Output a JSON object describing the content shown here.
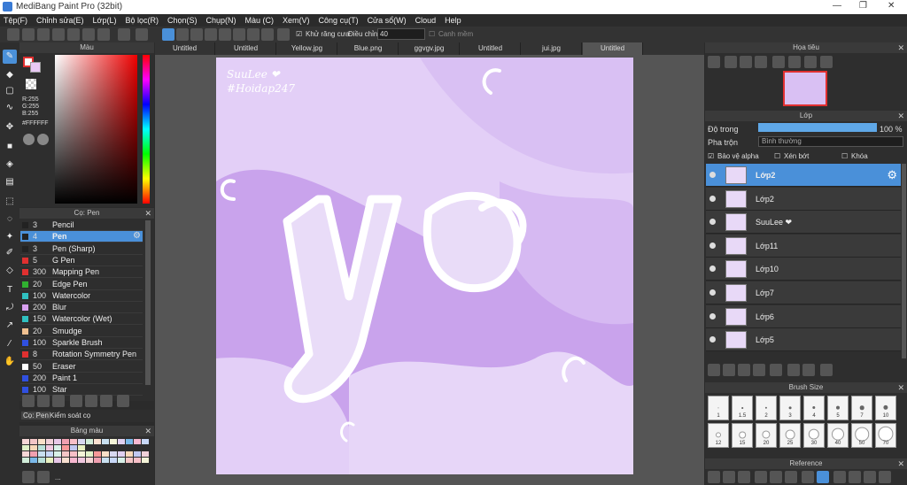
{
  "title": "MediBang Paint Pro (32bit)",
  "menu": [
    "Tệp(F)",
    "Chỉnh sửa(E)",
    "Lớp(L)",
    "Bộ lọc(R)",
    "Chọn(S)",
    "Chụp(N)",
    "Màu (C)",
    "Xem(V)",
    "Công cụ(T)",
    "Cửa sổ(W)",
    "Cloud",
    "Help"
  ],
  "toolbar": {
    "antialias_label": "Khử răng cưa",
    "adjust_label": "Điều chỉnh",
    "adjust_value": "40",
    "soften_label": "Canh mềm"
  },
  "color_panel": {
    "title": "Màu",
    "r": "R:255",
    "g": "G:255",
    "b": "B:255",
    "hex": "#FFFFFF"
  },
  "brush_panel": {
    "title": "Cọ: Pen",
    "items": [
      {
        "size": "3",
        "name": "Pencil",
        "color": "#222222"
      },
      {
        "size": "4",
        "name": "Pen",
        "color": "#222222"
      },
      {
        "size": "3",
        "name": "Pen (Sharp)",
        "color": "#222222"
      },
      {
        "size": "5",
        "name": "G Pen",
        "color": "#e03030"
      },
      {
        "size": "300",
        "name": "Mapping Pen",
        "color": "#e03030"
      },
      {
        "size": "20",
        "name": "Edge Pen",
        "color": "#30b030"
      },
      {
        "size": "100",
        "name": "Watercolor",
        "color": "#30c0c0"
      },
      {
        "size": "200",
        "name": "Blur",
        "color": "#d8a0f0"
      },
      {
        "size": "150",
        "name": "Watercolor (Wet)",
        "color": "#30c0c0"
      },
      {
        "size": "20",
        "name": "Smudge",
        "color": "#f0c090"
      },
      {
        "size": "100",
        "name": "Sparkle Brush",
        "color": "#3050e0"
      },
      {
        "size": "8",
        "name": "Rotation Symmetry Pen",
        "color": "#e03030"
      },
      {
        "size": "50",
        "name": "Eraser",
        "color": "#ffffff"
      },
      {
        "size": "200",
        "name": "Paint 1",
        "color": "#3050e0"
      },
      {
        "size": "100",
        "name": "Star",
        "color": "#3050e0"
      }
    ]
  },
  "brush_tabs": [
    "Cọ: Pen",
    "Kiểm soát cọ"
  ],
  "palette_panel": {
    "title": "Bảng màu",
    "ellipsis": "..."
  },
  "doc_tabs": [
    "Untitled",
    "Untitled",
    "Yellow.jpg",
    "Blue.png",
    "ggvgv.jpg",
    "Untitled",
    "jui.jpg",
    "Untitled"
  ],
  "canvas": {
    "signature": "SuuLee ❤",
    "hashtag": "#Hoidap247",
    "art_text": "yo"
  },
  "navigator": {
    "title": "Họa tiêu"
  },
  "layer_panel": {
    "title": "Lớp",
    "opacity_label": "Độ trong",
    "opacity_value": "100 %",
    "opacity": 1.0,
    "blend_label": "Pha trộn",
    "blend_value": "Bình thường",
    "protect_alpha": "Bảo vệ alpha",
    "clipping": "Xén bớt",
    "lock": "Khóa",
    "layers": [
      "Lớp2",
      "Lớp2",
      "SuuLee ❤",
      "Lớp11",
      "Lớp10",
      "Lớp7",
      "Lớp6",
      "Lớp5"
    ]
  },
  "brush_size_panel": {
    "title": "Brush Size",
    "row1": [
      "1",
      "1.5",
      "2",
      "3",
      "4",
      "5",
      "7",
      "10"
    ],
    "row2": [
      "12",
      "15",
      "20",
      "25",
      "30",
      "40",
      "50",
      "70"
    ]
  },
  "reference_panel": {
    "title": "Reference"
  }
}
